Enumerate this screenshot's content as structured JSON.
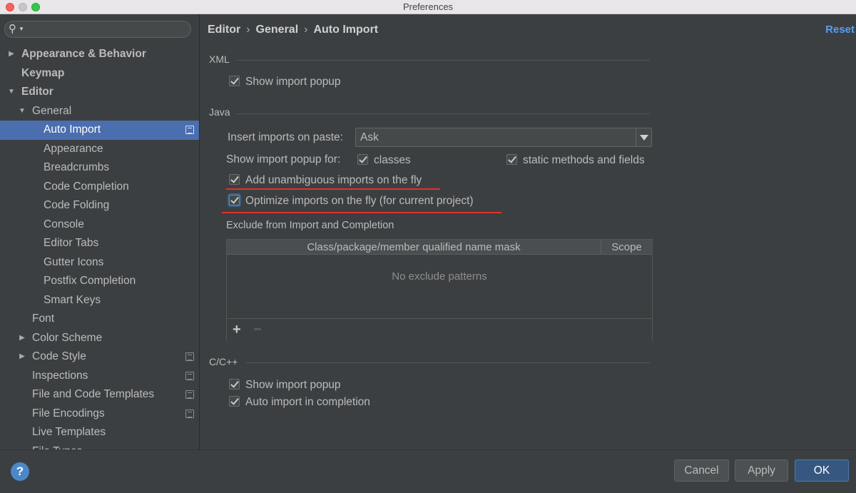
{
  "window": {
    "title": "Preferences"
  },
  "search": {
    "placeholder": ""
  },
  "sidebar": {
    "items": [
      {
        "label": "Appearance & Behavior",
        "level": 0,
        "bold": true,
        "expanded": false,
        "has_arrow": true,
        "badge": false,
        "selected": false
      },
      {
        "label": "Keymap",
        "level": 0,
        "bold": true,
        "expanded": false,
        "has_arrow": false,
        "badge": false,
        "selected": false
      },
      {
        "label": "Editor",
        "level": 0,
        "bold": true,
        "expanded": true,
        "has_arrow": true,
        "badge": false,
        "selected": false
      },
      {
        "label": "General",
        "level": 1,
        "bold": false,
        "expanded": true,
        "has_arrow": true,
        "badge": false,
        "selected": false
      },
      {
        "label": "Auto Import",
        "level": 2,
        "bold": false,
        "expanded": false,
        "has_arrow": false,
        "badge": true,
        "selected": true
      },
      {
        "label": "Appearance",
        "level": 2,
        "bold": false,
        "expanded": false,
        "has_arrow": false,
        "badge": false,
        "selected": false
      },
      {
        "label": "Breadcrumbs",
        "level": 2,
        "bold": false,
        "expanded": false,
        "has_arrow": false,
        "badge": false,
        "selected": false
      },
      {
        "label": "Code Completion",
        "level": 2,
        "bold": false,
        "expanded": false,
        "has_arrow": false,
        "badge": false,
        "selected": false
      },
      {
        "label": "Code Folding",
        "level": 2,
        "bold": false,
        "expanded": false,
        "has_arrow": false,
        "badge": false,
        "selected": false
      },
      {
        "label": "Console",
        "level": 2,
        "bold": false,
        "expanded": false,
        "has_arrow": false,
        "badge": false,
        "selected": false
      },
      {
        "label": "Editor Tabs",
        "level": 2,
        "bold": false,
        "expanded": false,
        "has_arrow": false,
        "badge": false,
        "selected": false
      },
      {
        "label": "Gutter Icons",
        "level": 2,
        "bold": false,
        "expanded": false,
        "has_arrow": false,
        "badge": false,
        "selected": false
      },
      {
        "label": "Postfix Completion",
        "level": 2,
        "bold": false,
        "expanded": false,
        "has_arrow": false,
        "badge": false,
        "selected": false
      },
      {
        "label": "Smart Keys",
        "level": 2,
        "bold": false,
        "expanded": false,
        "has_arrow": false,
        "badge": false,
        "selected": false
      },
      {
        "label": "Font",
        "level": 1,
        "bold": false,
        "expanded": false,
        "has_arrow": false,
        "badge": false,
        "selected": false
      },
      {
        "label": "Color Scheme",
        "level": 1,
        "bold": false,
        "expanded": false,
        "has_arrow": true,
        "badge": false,
        "selected": false
      },
      {
        "label": "Code Style",
        "level": 1,
        "bold": false,
        "expanded": false,
        "has_arrow": true,
        "badge": true,
        "selected": false
      },
      {
        "label": "Inspections",
        "level": 1,
        "bold": false,
        "expanded": false,
        "has_arrow": false,
        "badge": true,
        "selected": false
      },
      {
        "label": "File and Code Templates",
        "level": 1,
        "bold": false,
        "expanded": false,
        "has_arrow": false,
        "badge": true,
        "selected": false
      },
      {
        "label": "File Encodings",
        "level": 1,
        "bold": false,
        "expanded": false,
        "has_arrow": false,
        "badge": true,
        "selected": false
      },
      {
        "label": "Live Templates",
        "level": 1,
        "bold": false,
        "expanded": false,
        "has_arrow": false,
        "badge": false,
        "selected": false
      },
      {
        "label": "File Types",
        "level": 1,
        "bold": false,
        "expanded": false,
        "has_arrow": false,
        "badge": false,
        "selected": false
      }
    ]
  },
  "header": {
    "breadcrumb": [
      "Editor",
      "General",
      "Auto Import"
    ],
    "separator": "›",
    "reset_label": "Reset"
  },
  "xml": {
    "title": "XML",
    "show_import_popup": {
      "label": "Show import popup",
      "checked": true
    }
  },
  "java": {
    "title": "Java",
    "insert_imports_label": "Insert imports on paste:",
    "insert_imports_value": "Ask",
    "show_popup_for_label": "Show import popup for:",
    "classes": {
      "label": "classes",
      "checked": true
    },
    "static_methods": {
      "label": "static methods and fields",
      "checked": true
    },
    "add_unambiguous": {
      "label": "Add unambiguous imports on the fly",
      "checked": true
    },
    "optimize_imports": {
      "label": "Optimize imports on the fly (for current project)",
      "checked": true
    },
    "exclude_title": "Exclude from Import and Completion",
    "table": {
      "col_mask": "Class/package/member qualified name mask",
      "col_scope": "Scope",
      "empty_text": "No exclude patterns",
      "add_symbol": "+",
      "remove_symbol": "−"
    }
  },
  "cpp": {
    "title": "C/C++",
    "show_import_popup": {
      "label": "Show import popup",
      "checked": true
    },
    "auto_import_completion": {
      "label": "Auto import in completion",
      "checked": true
    }
  },
  "footer": {
    "help_symbol": "?",
    "cancel_label": "Cancel",
    "apply_label": "Apply",
    "ok_label": "OK"
  },
  "colors": {
    "background": "#3c3f41",
    "selection": "#4b6eaf",
    "link": "#589df6",
    "annotation": "#e3302a",
    "ok_button": "#365880"
  }
}
